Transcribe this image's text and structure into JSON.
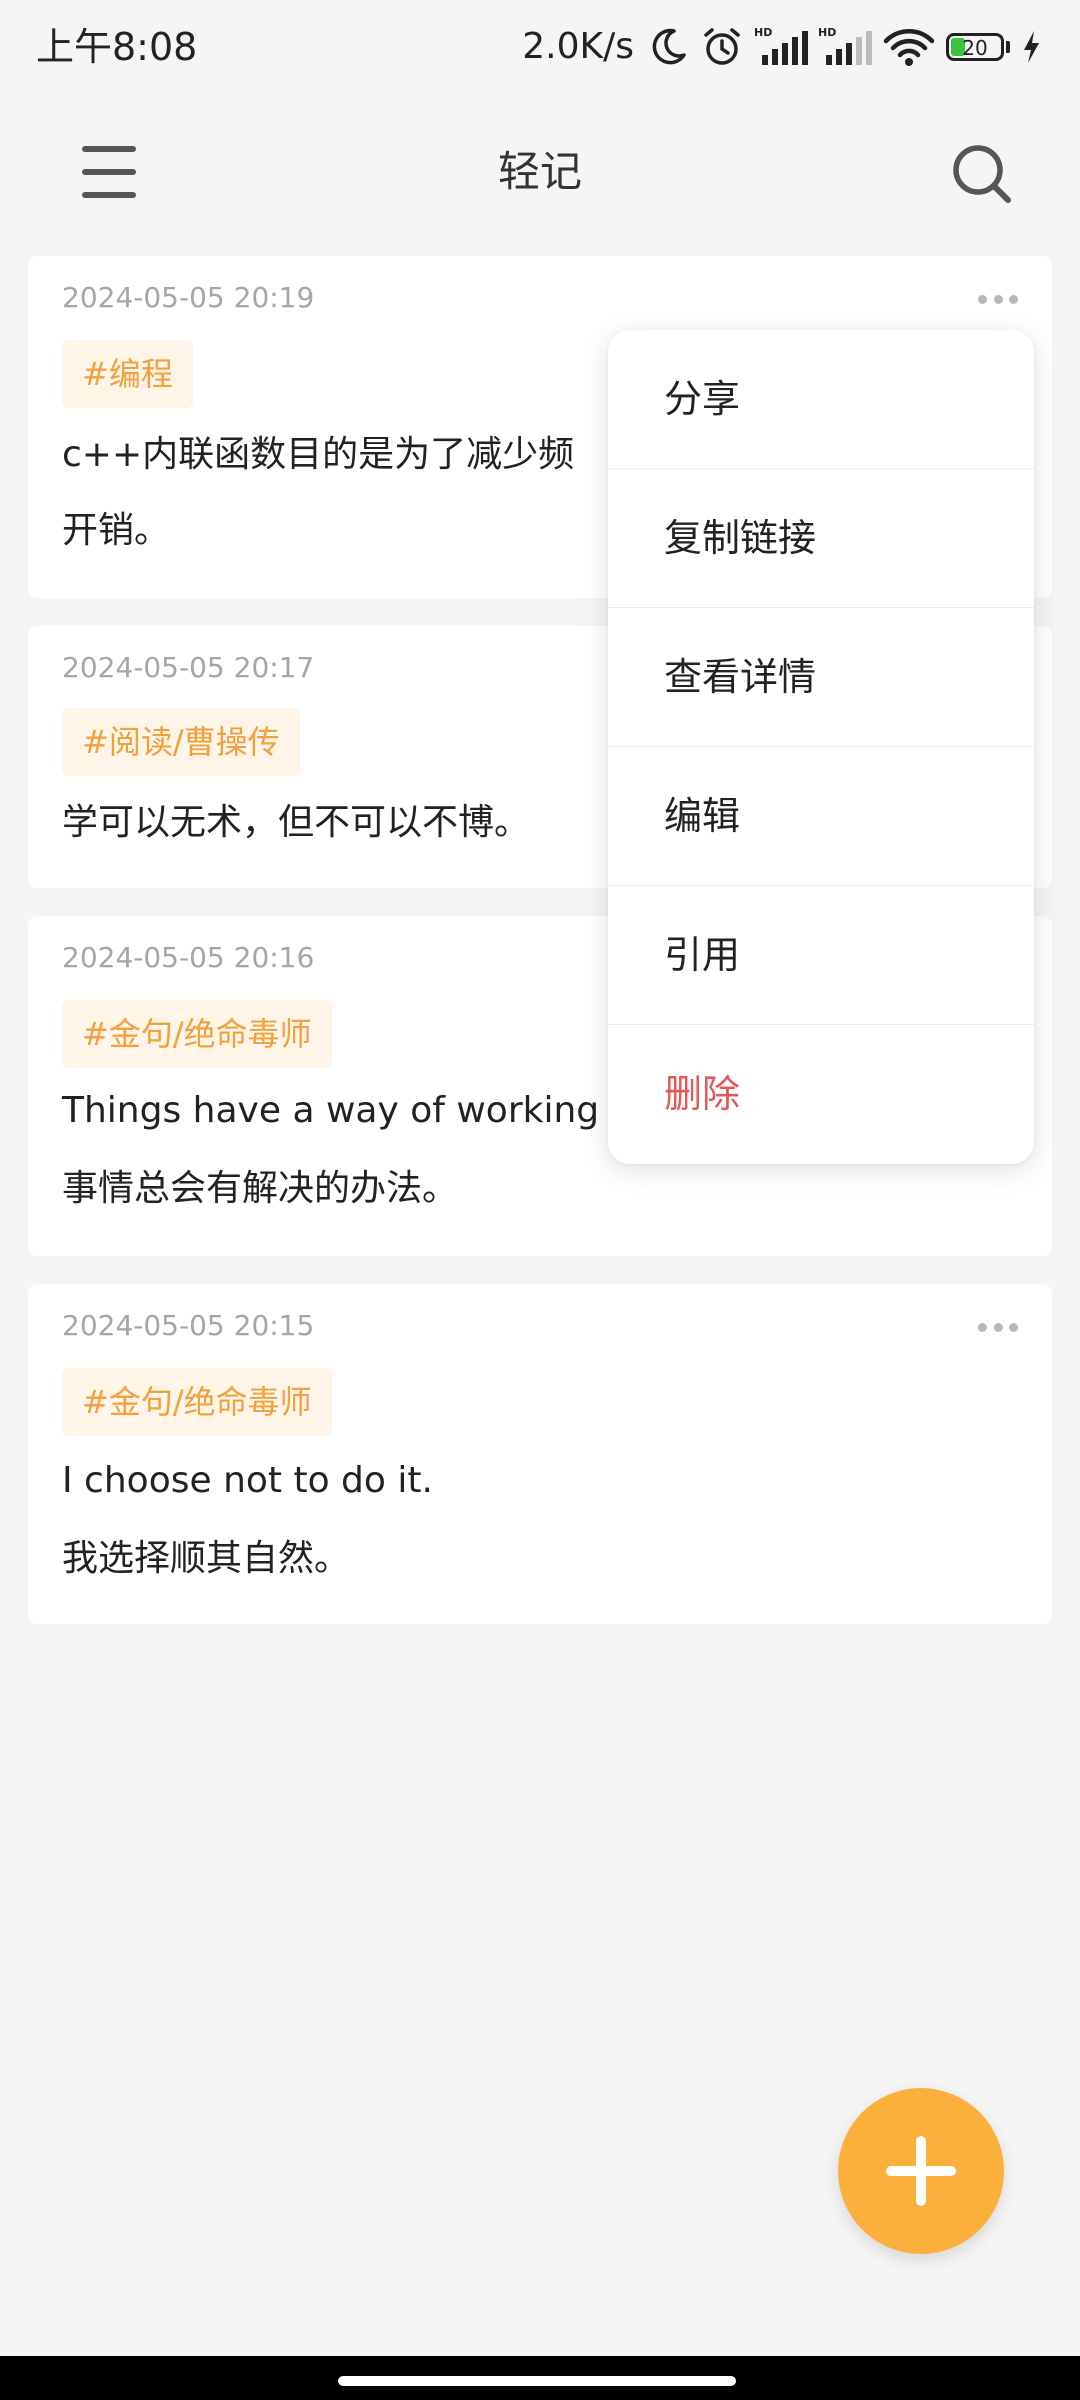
{
  "status_bar": {
    "time": "上午8:08",
    "net_speed": "2.0K/s",
    "battery_level": "20",
    "icons": [
      "moon-icon",
      "alarm-icon",
      "hd-signal-icon",
      "hd-signal-icon",
      "wifi-icon",
      "battery-icon",
      "charging-icon"
    ]
  },
  "header": {
    "title": "轻记",
    "menu_icon": "hamburger-menu-icon",
    "search_icon": "search-icon"
  },
  "notes": [
    {
      "date": "2024-05-05 20:19",
      "tag": "#编程",
      "lines": [
        "c++内联函数目的是为了减少频",
        "开销。"
      ]
    },
    {
      "date": "2024-05-05 20:17",
      "tag": "#阅读/曹操传",
      "lines": [
        "学可以无术，但不可以不博。"
      ]
    },
    {
      "date": "2024-05-05 20:16",
      "tag": "#金句/绝命毒师",
      "lines": [
        "Things have a way of working",
        "事情总会有解决的办法。"
      ]
    },
    {
      "date": "2024-05-05 20:15",
      "tag": "#金句/绝命毒师",
      "lines": [
        "I choose not to do it.",
        "我选择顺其自然。"
      ]
    }
  ],
  "context_menu": {
    "items": [
      {
        "label": "分享"
      },
      {
        "label": "复制链接"
      },
      {
        "label": "查看详情"
      },
      {
        "label": "编辑"
      },
      {
        "label": "引用"
      },
      {
        "label": "删除"
      }
    ]
  },
  "fab_icon": "plus-icon",
  "colors": {
    "accent": "#fbb03b",
    "tag_text": "#f0a13c",
    "tag_bg": "#fff4e8",
    "danger": "#e05858",
    "background": "#f5f5f5"
  }
}
